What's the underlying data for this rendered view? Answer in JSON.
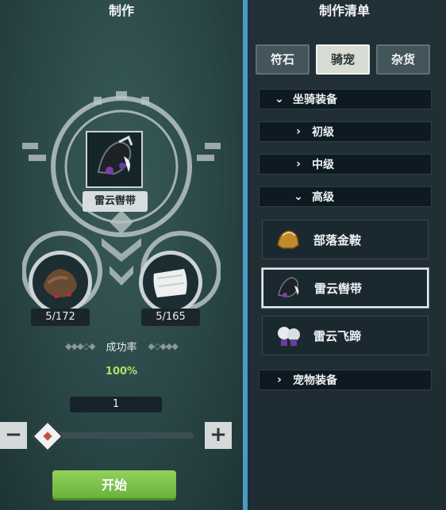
{
  "left_panel": {
    "title": "制作",
    "product": {
      "name": "雷云辔带",
      "icon": "black-harness-icon"
    },
    "materials": [
      {
        "icon": "brown-hide-icon",
        "count": "5/172"
      },
      {
        "icon": "white-fleece-icon",
        "count": "5/165"
      }
    ],
    "success_rate_label": "成功率",
    "success_rate_value": "100%",
    "quantity": "1",
    "minus_label": "−",
    "plus_label": "+",
    "start_label": "开始",
    "slider_level": 0.0
  },
  "right_panel": {
    "title": "制作清单",
    "tabs": [
      {
        "label": "符石",
        "active": false
      },
      {
        "label": "骑宠",
        "active": true
      },
      {
        "label": "杂货",
        "active": false
      }
    ],
    "categories": [
      {
        "label": "坐骑装备",
        "expanded": true
      },
      {
        "label": "初级",
        "expanded": false
      },
      {
        "label": "中级",
        "expanded": false
      },
      {
        "label": "高级",
        "expanded": true
      },
      {
        "label": "宠物装备",
        "expanded": false
      }
    ],
    "recipes": [
      {
        "label": "部落金鞍",
        "icon": "gold-saddle-icon",
        "selected": false
      },
      {
        "label": "雷云辔带",
        "icon": "black-harness-icon",
        "selected": true
      },
      {
        "label": "雷云飞蹄",
        "icon": "white-hooves-icon",
        "selected": false
      }
    ]
  },
  "colors": {
    "accent_green": "#a6e06b",
    "start_button": "#64b03a",
    "panel_dark": "#1a2930",
    "frame_light": "#cdd3d4"
  }
}
